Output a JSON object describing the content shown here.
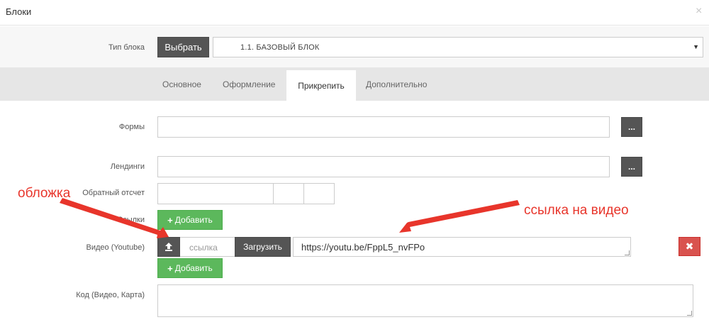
{
  "header": {
    "title": "Блоки",
    "close_label": "×"
  },
  "block_type": {
    "label": "Тип блока",
    "choose_label": "Выбрать",
    "selected": "1.1. БАЗОВЫЙ БЛОК",
    "arrow": "▼"
  },
  "tabs": [
    {
      "label": "Основное"
    },
    {
      "label": "Оформление"
    },
    {
      "label": "Прикрепить",
      "active": true
    },
    {
      "label": "Дополнительно"
    }
  ],
  "form": {
    "forms_label": "Формы",
    "landings_label": "Лендинги",
    "countdown_label": "Обратный отсчет",
    "links_label": "Ссылки",
    "video_label": "Видео (Youtube)",
    "code_label": "Код (Видео, Карта)",
    "dots_label": "...",
    "add_label": "Добавить",
    "plus": "+",
    "link_placeholder": "ссылка",
    "load_label": "Загрузить",
    "video_url": "https://youtu.be/FppL5_nvFPo",
    "remove_label": "✖"
  },
  "annotations": {
    "cover": "обложка",
    "video_link": "ссылка на видео"
  },
  "colors": {
    "green": "#5cb85c",
    "red": "#d9534f",
    "dark": "#555555",
    "annotation": "#e8352b"
  }
}
